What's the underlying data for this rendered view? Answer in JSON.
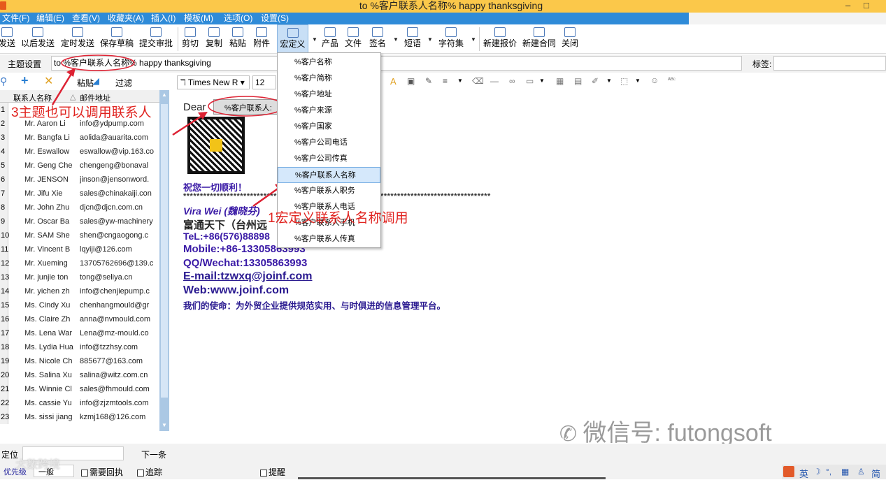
{
  "window": {
    "title": "to %客户联系人名称% happy thanksgiving",
    "minimize": "–",
    "maximize": "□"
  },
  "menu": [
    "文件(F)",
    "编辑(E)",
    "查看(V)",
    "收藏夹(A)",
    "插入(I)",
    "模板(M)",
    "选项(O)",
    "设置(S)"
  ],
  "toolbar": {
    "send": "发送",
    "send_later": "以后发送",
    "timed_send": "定时发送",
    "save_draft": "保存草稿",
    "submit_review": "提交审批",
    "cut": "剪切",
    "copy": "复制",
    "paste": "粘贴",
    "attach": "附件",
    "macro": "宏定义",
    "product": "产品",
    "file": "文件",
    "signature": "签名",
    "phrases": "短语",
    "charset": "字符集",
    "new_quote": "新建报价",
    "new_contract": "新建合同",
    "close": "关闭"
  },
  "subject": {
    "label": "主题设置",
    "value": "to %客户联系人名称% happy thanksgiving",
    "tag_label": "标签:"
  },
  "left_toolbar": {
    "paste": "粘贴",
    "filter": "过滤"
  },
  "list_headers": {
    "name": "联系人名称",
    "email": "邮件地址"
  },
  "contacts": [
    {
      "num": "1",
      "name": "",
      "email": ""
    },
    {
      "num": "2",
      "name": "Mr. Aaron Li",
      "email": "info@ydpump.com"
    },
    {
      "num": "3",
      "name": "Mr. Bangfa Li",
      "email": "aolida@auarita.com"
    },
    {
      "num": "4",
      "name": "Mr. Eswallow",
      "email": "eswallow@vip.163.co"
    },
    {
      "num": "5",
      "name": "Mr. Geng Che",
      "email": "chengeng@bonaval"
    },
    {
      "num": "6",
      "name": "Mr. JENSON",
      "email": "jinson@jensonword."
    },
    {
      "num": "7",
      "name": "Mr. Jifu Xie",
      "email": "sales@chinakaiji.con"
    },
    {
      "num": "8",
      "name": "Mr. John Zhu",
      "email": "djcn@djcn.com.cn"
    },
    {
      "num": "9",
      "name": "Mr. Oscar Ba",
      "email": "sales@yw-machinery"
    },
    {
      "num": "10",
      "name": "Mr. SAM She",
      "email": "shen@cngaogong.c"
    },
    {
      "num": "11",
      "name": "Mr. Vincent B",
      "email": "lqyiji@126.com"
    },
    {
      "num": "12",
      "name": "Mr. Xueming",
      "email": "13705762696@139.c"
    },
    {
      "num": "13",
      "name": "Mr. junjie ton",
      "email": "tong@seliya.cn"
    },
    {
      "num": "14",
      "name": "Mr. yichen zh",
      "email": "info@chenjiepump.c"
    },
    {
      "num": "15",
      "name": "Ms. Cindy Xu",
      "email": "chenhangmould@gr"
    },
    {
      "num": "16",
      "name": "Ms. Claire Zh",
      "email": "anna@nvmould.com"
    },
    {
      "num": "17",
      "name": "Ms. Lena War",
      "email": "Lena@mz-mould.co"
    },
    {
      "num": "18",
      "name": "Ms. Lydia Hua",
      "email": "info@tzzhsy.com"
    },
    {
      "num": "19",
      "name": "Ms. Nicole Ch",
      "email": "885677@163.com"
    },
    {
      "num": "20",
      "name": "Ms. Salina Xu",
      "email": "salina@witz.com.cn"
    },
    {
      "num": "21",
      "name": "Ms. Winnie Cl",
      "email": "sales@fhmould.com"
    },
    {
      "num": "22",
      "name": "Ms. cassie Yu",
      "email": "info@zjzmtools.com"
    },
    {
      "num": "23",
      "name": "Ms. sissi jiang",
      "email": "kzmj168@126.com"
    }
  ],
  "editor_toolbar": {
    "font": "Times New R",
    "size": "12"
  },
  "editor": {
    "dear": "Dear",
    "placeholder_tag": "%客户联系人:",
    "greeting": "祝您一切顺利！",
    "stars": "********************************************************************************************",
    "name_line": "Vira Wei (魏晓芬)",
    "company": "富通天下（台州远",
    "tel": "TeL:+86(576)88898",
    "mobile": "Mobile:+86-13305863993",
    "qq": "QQ/Wechat:13305863993",
    "email": "E-mail:tzwxq@joinf.com",
    "web": "Web:www.joinf.com",
    "mission": "我们的使命：为外贸企业提供规范实用、与时俱进的信息管理平台。"
  },
  "macro_menu": [
    "%客户名称",
    "%客户简称",
    "%客户地址",
    "%客户来源",
    "%客户国家",
    "%客户公司电话",
    "%客户公司传真",
    "%客户联系人名称",
    "%客户联系人职务",
    "%客户联系人电话",
    "%客户联系人手机",
    "%客户联系人传真"
  ],
  "annotations": {
    "a1": "1宏定义联系人名称调用",
    "a3": "3主题也可以调用联系人"
  },
  "bottom": {
    "locate": "定位",
    "next": "下一条",
    "priority": "优先级",
    "normal": "一般",
    "need_receipt": "需要回执",
    "track": "追踪",
    "remind": "提醒"
  },
  "watermarks": {
    "wechat": "微信号: futongsoft",
    "logo": "大数跨境"
  },
  "tray": {
    "lang": "英",
    "simp": "简"
  }
}
